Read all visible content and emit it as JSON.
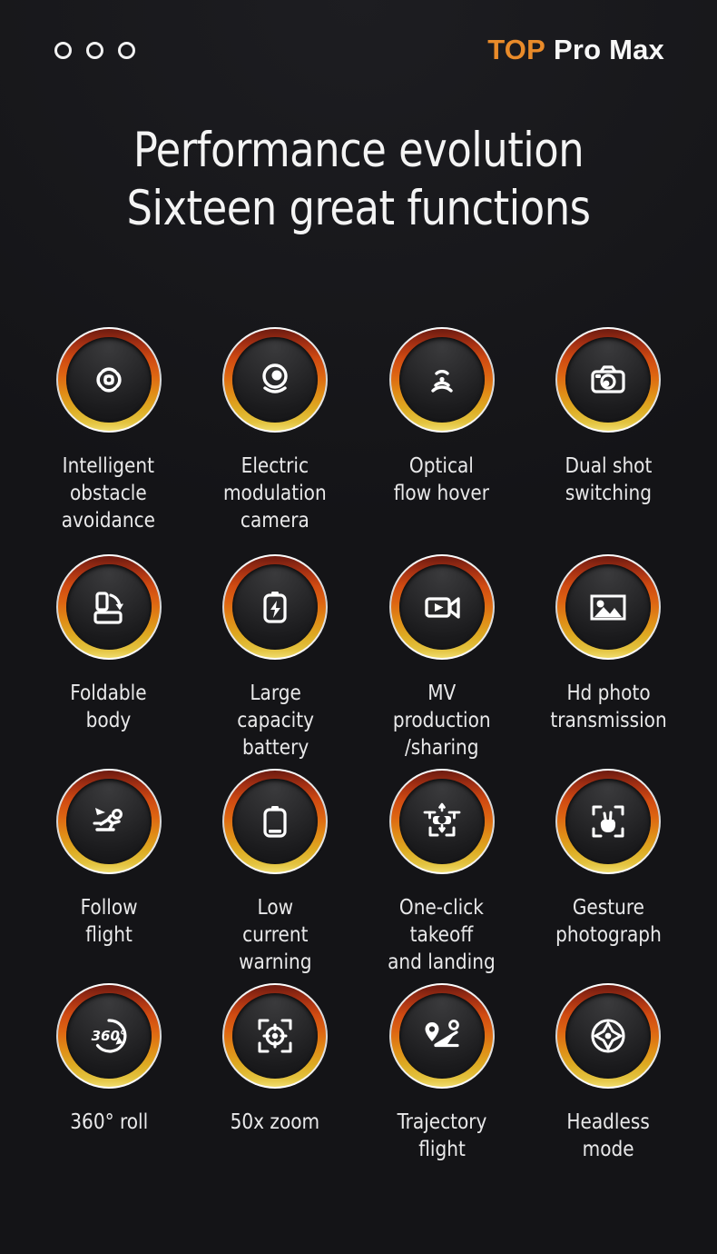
{
  "header": {
    "dots_icon": "three-circles-icon",
    "dots_count": 3,
    "brand_highlight": "TOP",
    "brand_rest": "Pro Max",
    "brand_highlight_color": "#e98b2a",
    "brand_rest_color": "#f7f7f7"
  },
  "title": {
    "line1": "Performance evolution",
    "line2": "Sixteen great functions"
  },
  "theme": {
    "background": "#141417",
    "ring_top": "#6d1b10",
    "ring_mid": "#dd6412",
    "ring_bottom": "#f0dc6c",
    "text": "#e9e9ea"
  },
  "features": [
    {
      "icon": "obstacle-sensor-icon",
      "label": "Intelligent\nobstacle\navoidance"
    },
    {
      "icon": "gimbal-camera-icon",
      "label": "Electric\nmodulation\ncamera"
    },
    {
      "icon": "optical-flow-icon",
      "label": "Optical\nflow hover"
    },
    {
      "icon": "camera-icon",
      "label": "Dual shot\nswitching"
    },
    {
      "icon": "foldable-body-icon",
      "label": "Foldable\nbody"
    },
    {
      "icon": "battery-charge-icon",
      "label": "Large\ncapacity\nbattery"
    },
    {
      "icon": "video-camera-icon",
      "label": "MV\nproduction\n/sharing"
    },
    {
      "icon": "photo-image-icon",
      "label": "Hd photo\ntransmission"
    },
    {
      "icon": "follow-running-icon",
      "label": "Follow\nflight"
    },
    {
      "icon": "battery-low-icon",
      "label": "Low\ncurrent\nwarning"
    },
    {
      "icon": "drone-takeoff-landing-icon",
      "label": "One-click\ntakeoff\nand landing"
    },
    {
      "icon": "gesture-hand-icon",
      "label": "Gesture\nphotograph"
    },
    {
      "icon": "360-rotate-icon",
      "label": "360°  roll"
    },
    {
      "icon": "zoom-target-icon",
      "label": "50x zoom"
    },
    {
      "icon": "trajectory-route-icon",
      "label": "Trajectory\nflight"
    },
    {
      "icon": "compass-headless-icon",
      "label": "Headless\nmode"
    }
  ]
}
